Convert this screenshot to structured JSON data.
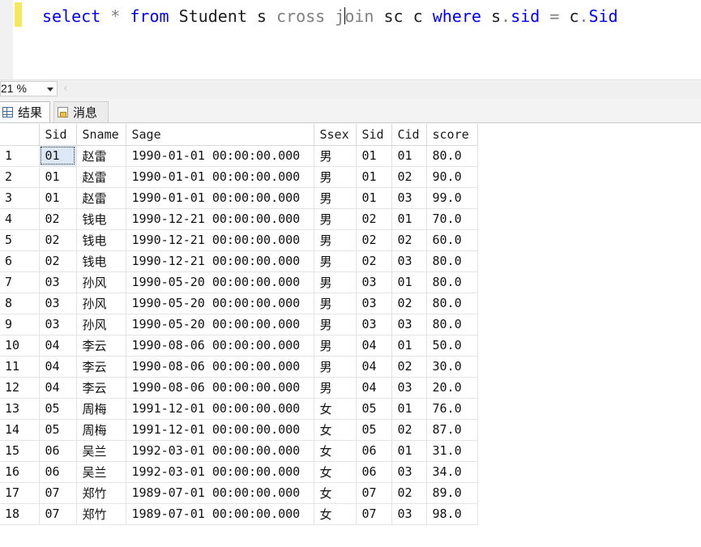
{
  "editor": {
    "tokens": [
      {
        "text": "select",
        "cls": "kw"
      },
      {
        "text": " ",
        "cls": ""
      },
      {
        "text": "*",
        "cls": "op"
      },
      {
        "text": " ",
        "cls": ""
      },
      {
        "text": "from",
        "cls": "kw"
      },
      {
        "text": " Student s ",
        "cls": ""
      },
      {
        "text": "cross",
        "cls": "kw-gray"
      },
      {
        "text": " ",
        "cls": ""
      },
      {
        "text": "j",
        "cls": "kw-gray"
      },
      {
        "text": "|",
        "cls": "caret"
      },
      {
        "text": "oin",
        "cls": "kw-gray"
      },
      {
        "text": " sc c ",
        "cls": ""
      },
      {
        "text": "where",
        "cls": "kw"
      },
      {
        "text": " s",
        "cls": ""
      },
      {
        "text": ".",
        "cls": "op"
      },
      {
        "text": "sid",
        "cls": "kw"
      },
      {
        "text": " ",
        "cls": ""
      },
      {
        "text": "=",
        "cls": "op"
      },
      {
        "text": " c",
        "cls": ""
      },
      {
        "text": ".",
        "cls": "op"
      },
      {
        "text": "Sid",
        "cls": "kw"
      }
    ]
  },
  "zoom": {
    "value": "21 %"
  },
  "tabs": {
    "results": "结果",
    "messages": "消息"
  },
  "grid": {
    "columns": [
      "Sid",
      "Sname",
      "Sage",
      "Ssex",
      "Sid",
      "Cid",
      "score"
    ],
    "rows": [
      [
        "1",
        "01",
        "赵雷",
        "1990-01-01 00:00:00.000",
        "男",
        "01",
        "01",
        "80.0"
      ],
      [
        "2",
        "01",
        "赵雷",
        "1990-01-01 00:00:00.000",
        "男",
        "01",
        "02",
        "90.0"
      ],
      [
        "3",
        "01",
        "赵雷",
        "1990-01-01 00:00:00.000",
        "男",
        "01",
        "03",
        "99.0"
      ],
      [
        "4",
        "02",
        "钱电",
        "1990-12-21 00:00:00.000",
        "男",
        "02",
        "01",
        "70.0"
      ],
      [
        "5",
        "02",
        "钱电",
        "1990-12-21 00:00:00.000",
        "男",
        "02",
        "02",
        "60.0"
      ],
      [
        "6",
        "02",
        "钱电",
        "1990-12-21 00:00:00.000",
        "男",
        "02",
        "03",
        "80.0"
      ],
      [
        "7",
        "03",
        "孙风",
        "1990-05-20 00:00:00.000",
        "男",
        "03",
        "01",
        "80.0"
      ],
      [
        "8",
        "03",
        "孙风",
        "1990-05-20 00:00:00.000",
        "男",
        "03",
        "02",
        "80.0"
      ],
      [
        "9",
        "03",
        "孙风",
        "1990-05-20 00:00:00.000",
        "男",
        "03",
        "03",
        "80.0"
      ],
      [
        "10",
        "04",
        "李云",
        "1990-08-06 00:00:00.000",
        "男",
        "04",
        "01",
        "50.0"
      ],
      [
        "11",
        "04",
        "李云",
        "1990-08-06 00:00:00.000",
        "男",
        "04",
        "02",
        "30.0"
      ],
      [
        "12",
        "04",
        "李云",
        "1990-08-06 00:00:00.000",
        "男",
        "04",
        "03",
        "20.0"
      ],
      [
        "13",
        "05",
        "周梅",
        "1991-12-01 00:00:00.000",
        "女",
        "05",
        "01",
        "76.0"
      ],
      [
        "14",
        "05",
        "周梅",
        "1991-12-01 00:00:00.000",
        "女",
        "05",
        "02",
        "87.0"
      ],
      [
        "15",
        "06",
        "吴兰",
        "1992-03-01 00:00:00.000",
        "女",
        "06",
        "01",
        "31.0"
      ],
      [
        "16",
        "06",
        "吴兰",
        "1992-03-01 00:00:00.000",
        "女",
        "06",
        "03",
        "34.0"
      ],
      [
        "17",
        "07",
        "郑竹",
        "1989-07-01 00:00:00.000",
        "女",
        "07",
        "02",
        "89.0"
      ],
      [
        "18",
        "07",
        "郑竹",
        "1989-07-01 00:00:00.000",
        "女",
        "07",
        "03",
        "98.0"
      ]
    ]
  }
}
